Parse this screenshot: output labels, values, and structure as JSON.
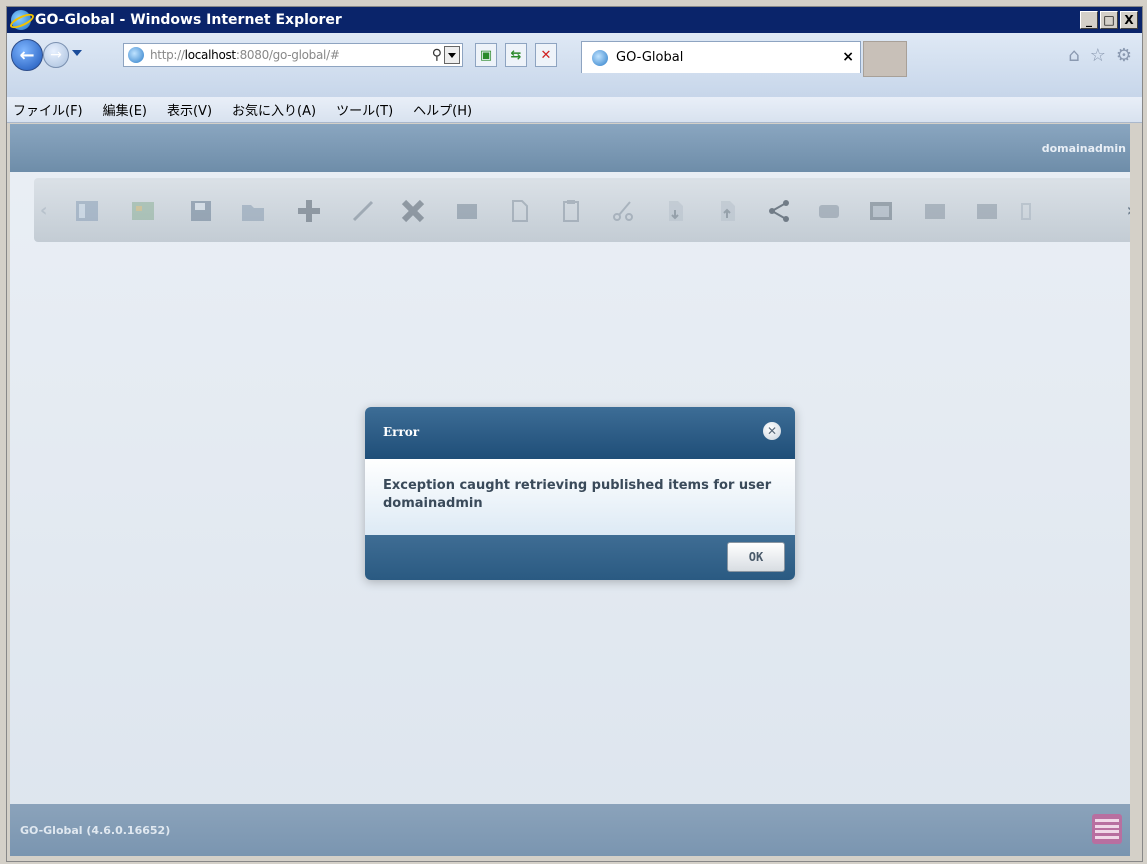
{
  "window": {
    "title": "GO-Global - Windows Internet Explorer",
    "min": "_",
    "max": "□",
    "close": "X"
  },
  "nav": {
    "url_prefix": "http://",
    "url_host": "localhost",
    "url_rest": ":8080/go-global/#",
    "tab_title": "GO-Global",
    "tab_close": "×"
  },
  "menu": [
    "ファイル(F)",
    "編集(E)",
    "表示(V)",
    "お気に入り(A)",
    "ツール(T)",
    "ヘルプ(H)"
  ],
  "header": {
    "user": "domainadmin"
  },
  "toolbar": {
    "icons": [
      "sidebar-icon",
      "map-icon",
      "save-icon",
      "folder-open-icon",
      "plus-icon",
      "edit-pen-icon",
      "delete-x-icon",
      "publish-icon",
      "document-icon",
      "clipboard-icon",
      "scissors-icon",
      "import-icon",
      "export-icon",
      "share-icon",
      "group-icon",
      "window-icon",
      "images-icon",
      "images-alt-icon",
      "more-icon"
    ]
  },
  "dialog": {
    "title": "Error",
    "message": "Exception caught retrieving published items for user domainadmin",
    "ok_label": "OK"
  },
  "footer": {
    "version": "GO-Global (4.6.0.16652)"
  }
}
